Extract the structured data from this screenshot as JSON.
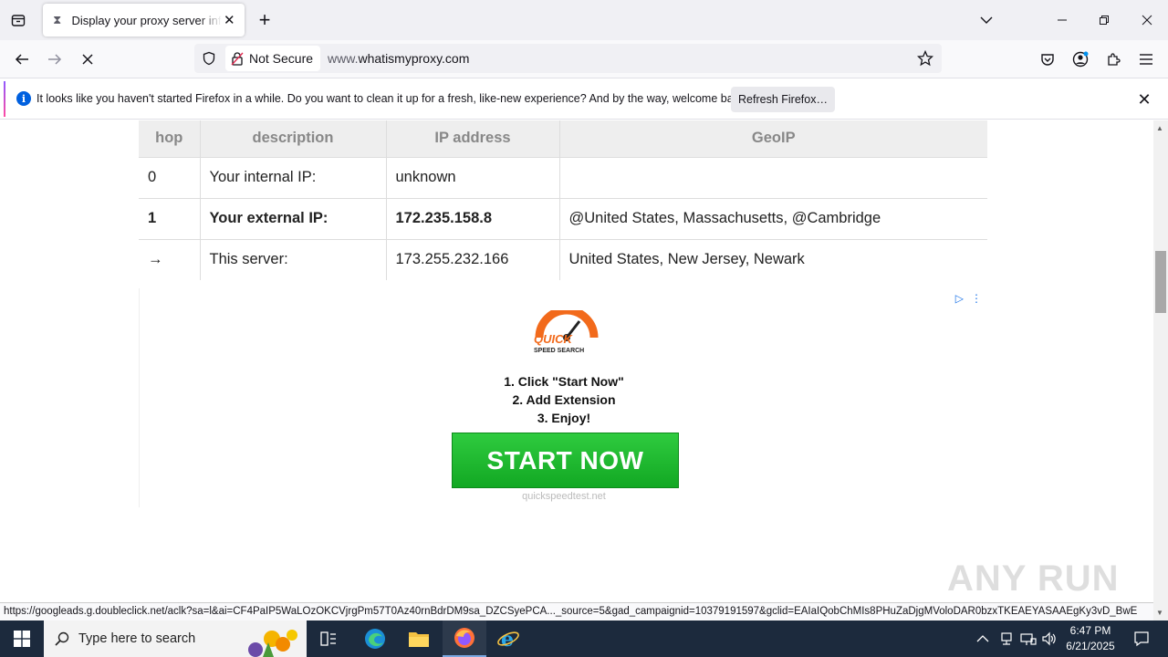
{
  "browser": {
    "tab_title": "Display your proxy server information",
    "url_prefix": "www.",
    "url_domain": "whatismyproxy.com",
    "security_label": "Not Secure"
  },
  "notification": {
    "message": "It looks like you haven't started Firefox in a while. Do you want to clean it up for a fresh, like-new experience? And by the way, welcome back!",
    "button_label": "Refresh Firefox…",
    "info_glyph": "i"
  },
  "table": {
    "headers": [
      "hop",
      "description",
      "IP address",
      "GeoIP"
    ],
    "rows": [
      {
        "hop": "0",
        "description": "Your internal IP:",
        "ip": "unknown",
        "geo": ""
      },
      {
        "hop": "1",
        "description": "Your external IP:",
        "ip": "172.235.158.8",
        "geo": "@United States, Massachusetts, @Cambridge"
      },
      {
        "hop": "→",
        "description": "This server:",
        "ip": "173.255.232.166",
        "geo": "United States, New Jersey, Newark"
      }
    ]
  },
  "ad": {
    "logo_text_1": "QUICK",
    "logo_text_2": "SPEED SEARCH",
    "step1": "1. Click \"Start Now\"",
    "step2": "2. Add Extension",
    "step3": "3. Enjoy!",
    "cta": "START NOW",
    "domain": "quickspeedtest.net"
  },
  "status_url": "https://googleads.g.doubleclick.net/aclk?sa=l&ai=CF4PaIP5WaLOzOKCVjrgPm57T0Az40rnBdrDM9sa_DZCSyePCA..._source=5&gad_campaignid=10379191597&gclid=EAIaIQobChMIs8PHuZaDjgMVoloDAR0bzxTKEAEYASAAEgKy3vD_BwE",
  "watermark": "ANY RUN",
  "taskbar": {
    "search_placeholder": "Type here to search",
    "time": "6:47 PM",
    "date": "6/21/2025"
  }
}
